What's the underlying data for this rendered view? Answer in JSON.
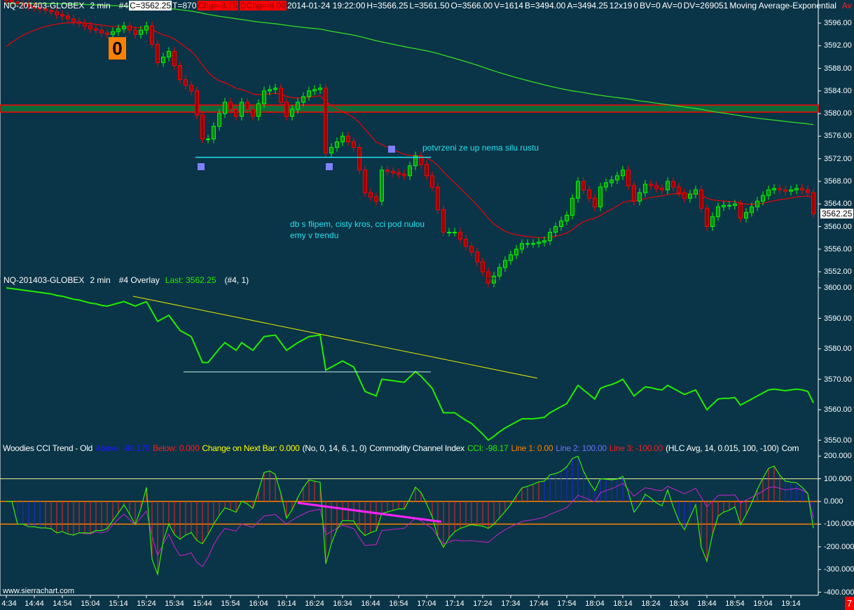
{
  "header": {
    "symbol": "NQ-201403-GLOBEX",
    "interval": "2 min",
    "chart_no": "#4",
    "close": "C=3562.25",
    "trades": "T=870",
    "chg": "Chg=-3.75",
    "dchg": "DChg=-9.00",
    "datetime": "2014-01-24 19:22:00",
    "high": "H=3566.25",
    "low": "L=3561.50",
    "open": "O=3566.00",
    "volume": "V=1614",
    "bid": "B=3494.00",
    "ask": "A=3494.25",
    "bar_size": "12x19",
    "zero": "0",
    "bv": "BV=0",
    "av": "AV=0",
    "dv": "DV=269051",
    "study1": "Moving Average-Exponential",
    "study2_cut": "Av"
  },
  "overlay_header": {
    "symbol": "NQ-201403-GLOBEX",
    "interval": "2 min",
    "name": "#4 Overlay",
    "last": "Last: 3562.25",
    "params": "(#4, 1)"
  },
  "cci_header": {
    "name": "Woodies CCI Trend - Old",
    "above": "Above: -98.170",
    "below": "Below: 0.000",
    "change": "Change on Next Bar: 0.000",
    "params": "(No, 0, 14, 6, 1, 0)",
    "cci_name": "Commodity Channel Index",
    "cci": "CCI: -98.17",
    "line1": "Line 1: 0.00",
    "line2": "Line 2: 100.00",
    "line3": "Line 3: -100.00",
    "cci_params": "(HLC Avg, 14, 0.015, 100, -100)",
    "cut": "Com"
  },
  "annotations": {
    "zero_marker": "0",
    "note_confirm": "potvrzeni ze up nema silu rustu",
    "note_db_line1": "db s flipem, cisty kros, cci pod nulou",
    "note_db_line2": "emy v trendu"
  },
  "last_price_label": "3562.25",
  "footer": {
    "site": "www.sierrachart.com",
    "badge": "7"
  },
  "colors": {
    "background": "#0a3447",
    "up": "#00ff00",
    "down": "#ff0000",
    "ema_fast": "#ff0000",
    "ema_slow": "#33dd22",
    "overlay": "#22ee00",
    "cci": "#33ee00",
    "cci_slow": "#cc22cc",
    "zone": "#0d6b3a",
    "annotation": "#1fe3f0"
  },
  "chart_data": [
    {
      "type": "candlestick",
      "title": "NQ-201403-GLOBEX 2 min #4",
      "ylim": [
        3550,
        3598
      ],
      "yticks": [
        "3596.00",
        "3592.00",
        "3588.00",
        "3584.00",
        "3580.00",
        "3576.00",
        "3572.00",
        "3568.00",
        "3564.00",
        "3560.00",
        "3556.00",
        "3552.00"
      ],
      "ema_fast_period": 20,
      "ema_fast_seed": 3591,
      "ema_slow_period": 220,
      "ema_slow_seed": 3599.5,
      "zone": [
        3580.25,
        3581.5
      ],
      "support_level": 3572.25,
      "closes": [
        3600,
        3599.75,
        3599.5,
        3599.25,
        3599,
        3598.75,
        3598.5,
        3598.25,
        3598,
        3597.5,
        3597.25,
        3596.75,
        3596.25,
        3596,
        3595.5,
        3595,
        3594.75,
        3594.25,
        3594,
        3594.5,
        3595,
        3595.5,
        3594.75,
        3594,
        3594.75,
        3595.5,
        3592.25,
        3589,
        3590,
        3591,
        3588.5,
        3586,
        3585,
        3584,
        3579.75,
        3575.5,
        3575.5,
        3577.75,
        3580,
        3582,
        3580.75,
        3579.5,
        3582,
        3580.75,
        3579.5,
        3581.75,
        3584,
        3584.25,
        3584.5,
        3582,
        3579.5,
        3580.75,
        3582,
        3583,
        3584,
        3584.25,
        3584.5,
        3573,
        3574,
        3575,
        3576,
        3575,
        3574,
        3570,
        3566,
        3565.25,
        3564.5,
        3570,
        3569.75,
        3569.5,
        3569.25,
        3569,
        3570.75,
        3572.5,
        3571,
        3569,
        3567,
        3563,
        3559,
        3559,
        3559,
        3557.75,
        3556.5,
        3555.5,
        3553.75,
        3552,
        3550,
        3551.25,
        3552.75,
        3554,
        3555,
        3556,
        3557,
        3557,
        3557,
        3557.25,
        3557.5,
        3559,
        3560,
        3561,
        3562,
        3565,
        3568,
        3566.5,
        3565,
        3563.5,
        3567,
        3567.75,
        3568.25,
        3569,
        3570,
        3567.25,
        3564.5,
        3566,
        3567.5,
        3567.25,
        3566.75,
        3566.5,
        3568,
        3567,
        3566,
        3565,
        3565.75,
        3566.5,
        3563.25,
        3560,
        3561.75,
        3563.5,
        3563.75,
        3563.75,
        3564,
        3561.5,
        3562.5,
        3563.5,
        3564.5,
        3565.5,
        3566.5,
        3566.75,
        3566.5,
        3566.25,
        3566.5,
        3566.75,
        3566.5,
        3566,
        3562.25
      ]
    },
    {
      "type": "line",
      "title": "#4 Overlay",
      "ylim": [
        3548,
        3602
      ],
      "yticks": [
        "3600.00",
        "3590.00",
        "3580.00",
        "3570.00",
        "3560.00",
        "3550.00"
      ],
      "source": "closes"
    },
    {
      "type": "line",
      "title": "Woodies CCI Trend / Commodity Channel Index",
      "ylim": [
        -400,
        200
      ],
      "yticks": [
        "200.000",
        "100.000",
        "0.000",
        "-100.000",
        "-200.000",
        "-300.000",
        "-400.000"
      ],
      "cci_period": 14,
      "cci_slow_period": 50,
      "levels": [
        100,
        0,
        -100
      ]
    }
  ],
  "x_axis": {
    "labels": [
      "4:34",
      "14:44",
      "14:54",
      "15:04",
      "15:14",
      "15:24",
      "15:34",
      "15:44",
      "15:54",
      "16:04",
      "16:14",
      "16:24",
      "16:34",
      "16:44",
      "16:54",
      "17:04",
      "17:14",
      "17:24",
      "17:34",
      "17:44",
      "17:54",
      "18:04",
      "18:14",
      "18:24",
      "18:34",
      "18:44",
      "18:54",
      "19:04",
      "19:14"
    ]
  }
}
